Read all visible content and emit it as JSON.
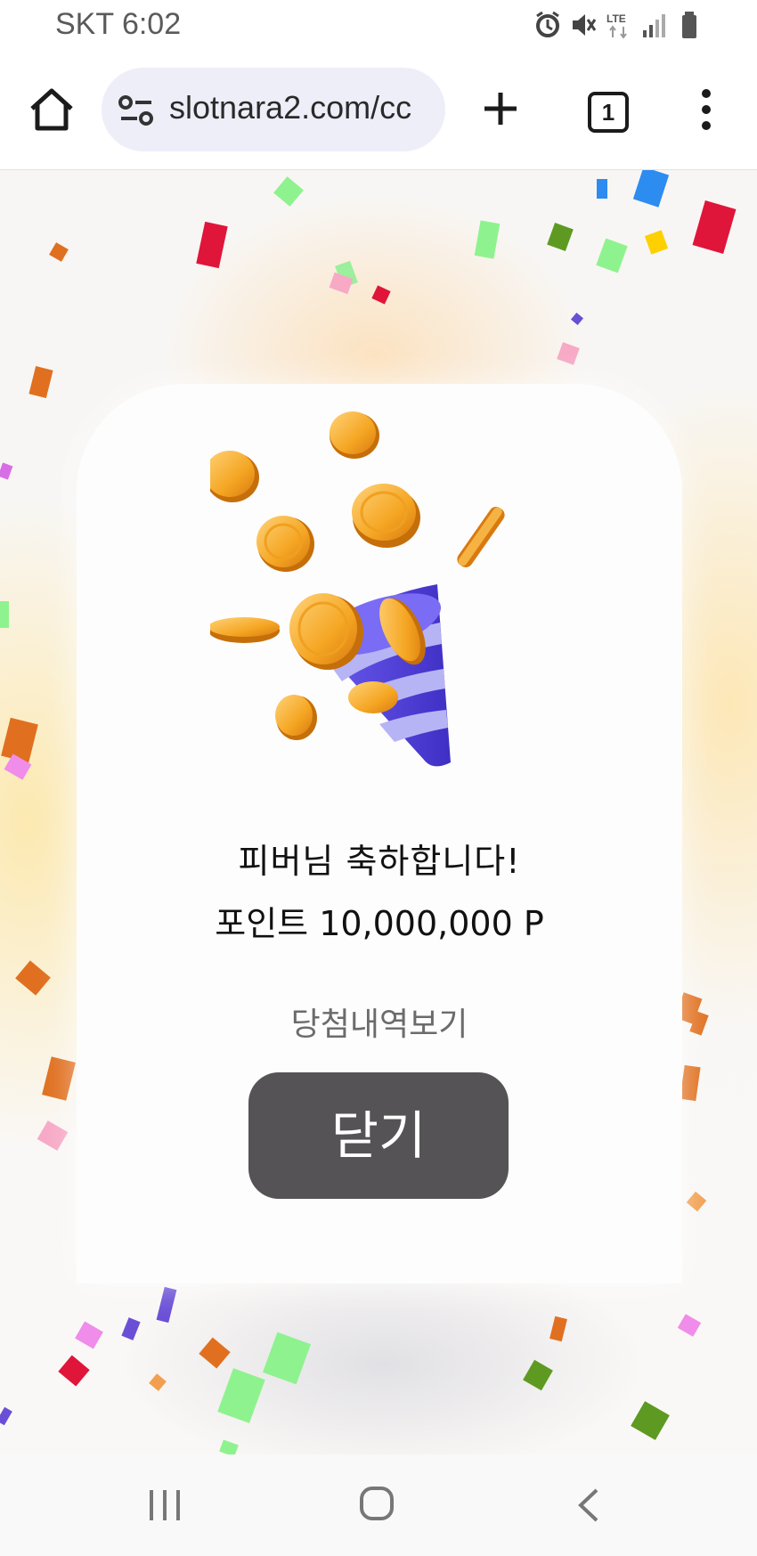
{
  "status_bar": {
    "time": "SKT 6:02",
    "icons": [
      "alarm-icon",
      "mute-icon",
      "lte-icon",
      "signal-icon",
      "battery-icon"
    ]
  },
  "browser": {
    "url": "slotnara2.com/cc",
    "tab_count": "1",
    "icons": [
      "home-icon",
      "site-settings-icon",
      "plus-icon",
      "tab-switcher-icon",
      "more-vert-icon"
    ]
  },
  "dialog": {
    "congrats_text": "피버님 축하합니다!",
    "points_text": "포인트 10,000,000 P",
    "history_link": "당첨내역보기",
    "close_label": "닫기"
  },
  "nav_bar": {
    "icons": [
      "recent-apps-icon",
      "home-circle-icon",
      "back-icon"
    ]
  },
  "colors": {
    "close_button_bg": "#555355",
    "card_bg": "#fdfdfd",
    "url_bar_bg": "#eeeef9",
    "coin_gold": "#f5a623",
    "cone_purple": "#5b4ee6"
  }
}
